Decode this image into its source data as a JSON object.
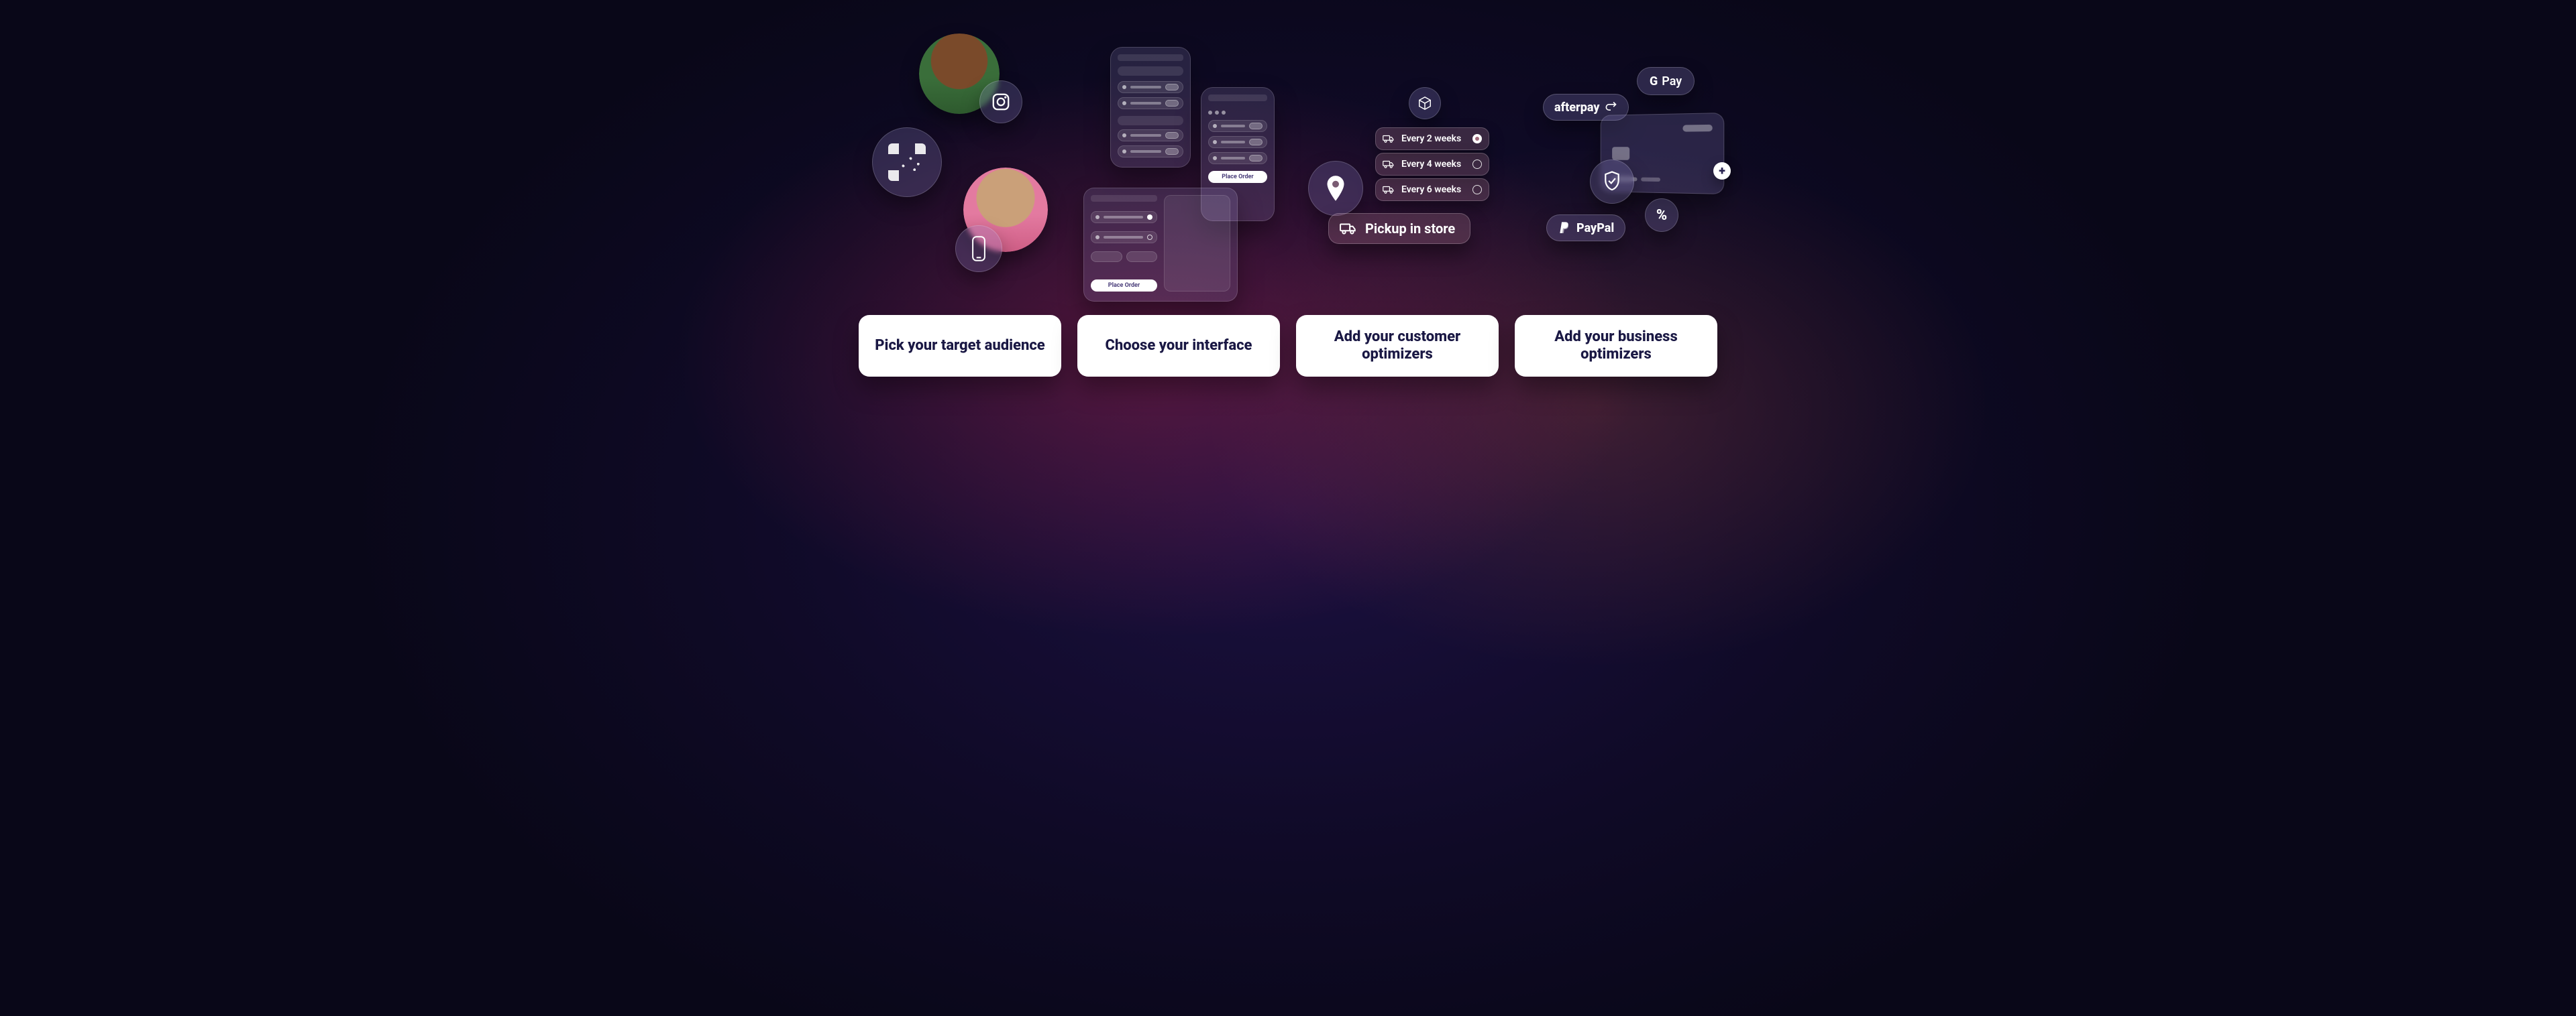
{
  "labels": [
    "Pick your target audience",
    "Choose your interface",
    "Add your customer optimizers",
    "Add your business optimizers"
  ],
  "cluster2": {
    "place_order": "Place Order"
  },
  "cluster3": {
    "opt1": "Every 2 weeks",
    "opt2": "Every 4 weeks",
    "opt3": "Every 6 weeks",
    "pickup": "Pickup in store"
  },
  "cluster4": {
    "gpay_g": "G",
    "gpay_pay": "Pay",
    "afterpay": "afterpay",
    "paypal": "PayPal",
    "plus": "+",
    "percent": "%"
  }
}
